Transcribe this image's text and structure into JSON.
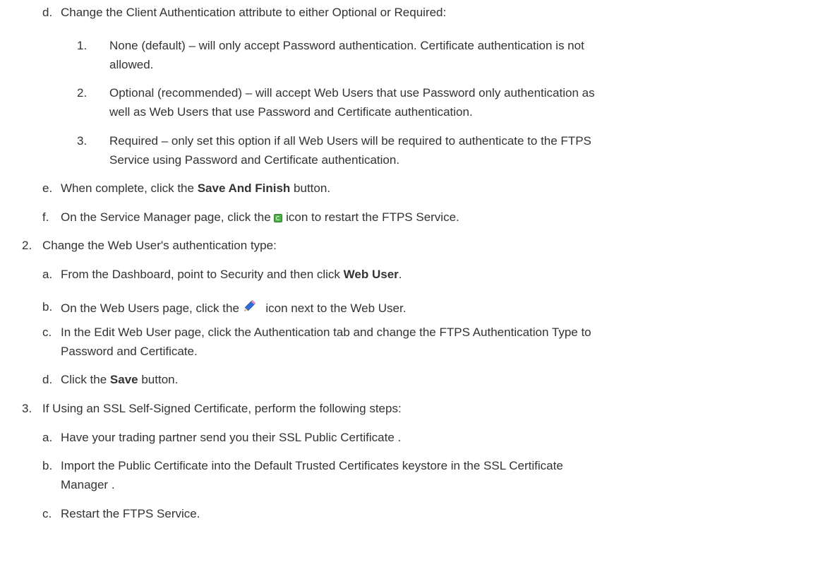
{
  "doc": {
    "step_1": {
      "d": {
        "marker": "d.",
        "text": "Change the Client Authentication attribute to either Optional or Required:",
        "options": [
          {
            "marker": "1.",
            "lines": [
              "None (default) – will only accept Password authentication. Certificate authentication is not",
              "allowed."
            ]
          },
          {
            "marker": "2.",
            "lines": [
              "Optional (recommended) – will accept Web Users that use Password only authentication as",
              "well as Web Users that use Password and Certificate authentication."
            ]
          },
          {
            "marker": "3.",
            "lines": [
              "Required – only set this option if all Web Users will be required to authenticate to the FTPS",
              "Service using Password and Certificate authentication."
            ]
          }
        ]
      },
      "e": {
        "marker": "e.",
        "pre": "When complete, click the ",
        "bold": "Save And Finish",
        "post": " button."
      },
      "f": {
        "marker": "f.",
        "pre": "On the Service Manager page, click the ",
        "post": " icon to restart the FTPS Service."
      }
    },
    "step_2": {
      "marker": "2.",
      "text": "Change the Web User's authentication type:",
      "a": {
        "marker": "a.",
        "pre": "From the Dashboard, point to Security and then click ",
        "bold": "Web User",
        "post": "."
      },
      "b": {
        "marker": "b.",
        "pre": "On the Web Users page, click the ",
        "post": " icon next to the Web User."
      },
      "c": {
        "marker": "c.",
        "lines": [
          "In the Edit Web User page, click the Authentication tab and change the FTPS Authentication Type to",
          "Password and Certificate."
        ]
      },
      "d": {
        "marker": "d.",
        "pre": "Click the ",
        "bold": "Save",
        "post": " button."
      }
    },
    "step_3": {
      "marker": "3.",
      "text": "If Using an SSL Self-Signed Certificate, perform the following steps:",
      "a": {
        "marker": "a.",
        "text": "Have your trading partner send you their SSL Public Certificate ."
      },
      "b": {
        "marker": "b.",
        "lines": [
          "Import the Public Certificate into the Default Trusted Certificates keystore in the SSL Certificate",
          "Manager ."
        ]
      },
      "c": {
        "marker": "c.",
        "text": "Restart the FTPS Service."
      }
    },
    "icons": {
      "restart": "refresh-icon",
      "edit": "pencil-icon"
    }
  }
}
